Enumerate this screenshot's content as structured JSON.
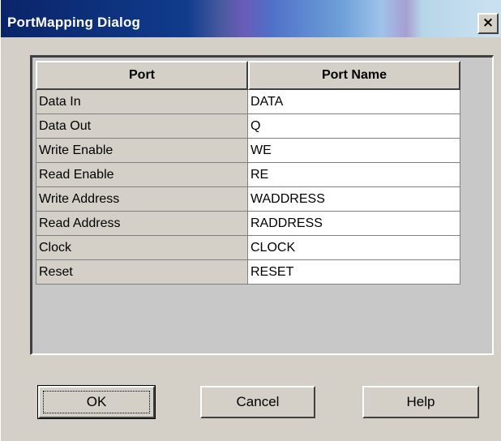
{
  "window": {
    "title": "PortMapping Dialog",
    "close_label": "×"
  },
  "table": {
    "headers": [
      "Port",
      "Port Name"
    ],
    "rows": [
      [
        "Data In",
        "DATA"
      ],
      [
        "Data Out",
        "Q"
      ],
      [
        "Write Enable",
        "WE"
      ],
      [
        "Read Enable",
        "RE"
      ],
      [
        "Write Address",
        "WADDRESS"
      ],
      [
        "Read Address",
        "RADDRESS"
      ],
      [
        "Clock",
        "CLOCK"
      ],
      [
        "Reset",
        "RESET"
      ]
    ]
  },
  "buttons": {
    "ok": "OK",
    "cancel": "Cancel",
    "help": "Help"
  }
}
